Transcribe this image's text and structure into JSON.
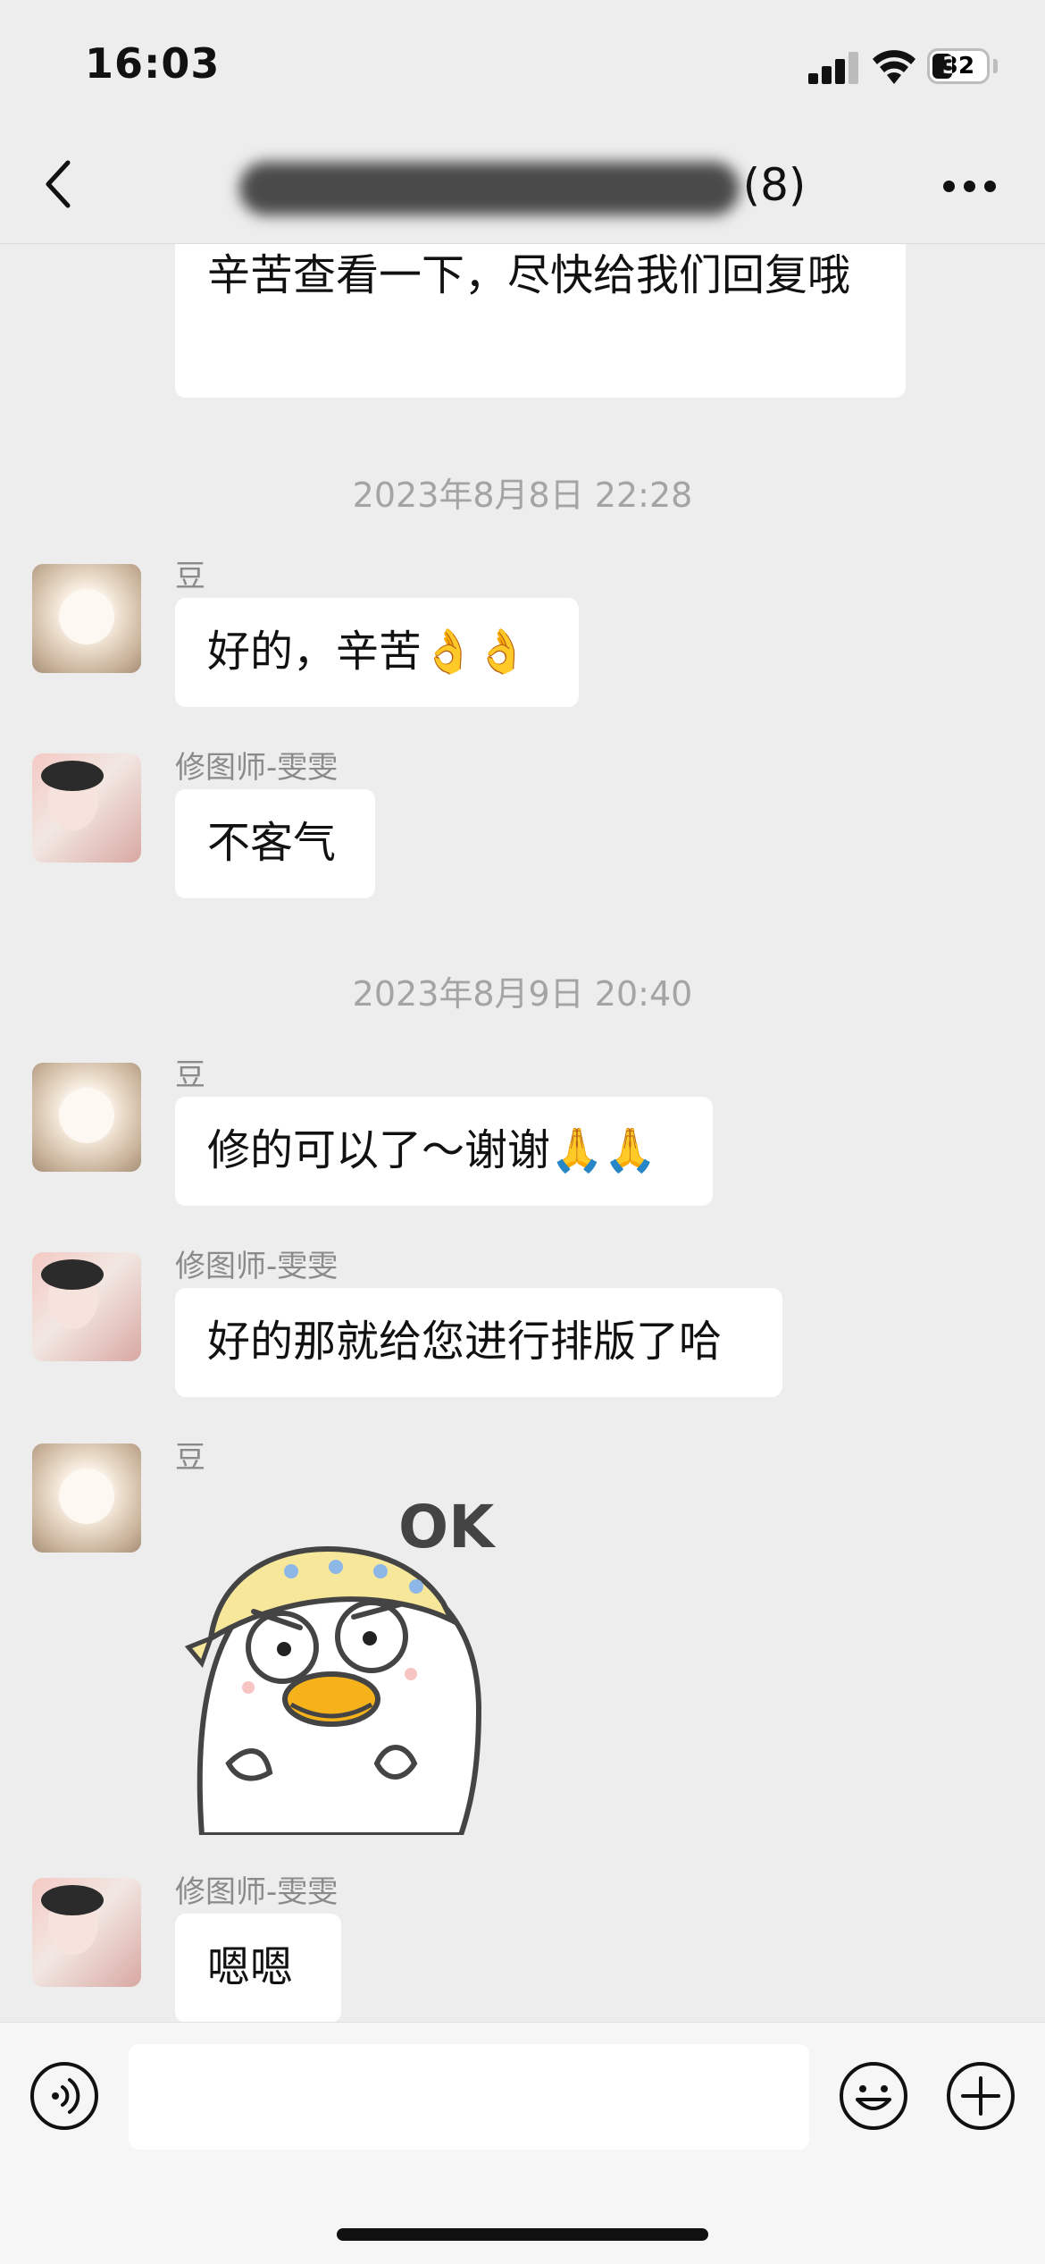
{
  "status_bar": {
    "time": "16:03",
    "battery": "32"
  },
  "header": {
    "title_visible": "27 12",
    "member_count": "(8)"
  },
  "messages": [
    {
      "text": "辛苦查看一下，尽快给我们回复哦"
    },
    {
      "timestamp": "2023年8月8日 22:28"
    },
    {
      "sender": "豆",
      "text": "好的，辛苦👌👌"
    },
    {
      "sender": "修图师-雯雯",
      "text": "不客气"
    },
    {
      "timestamp": "2023年8月9日 20:40"
    },
    {
      "sender": "豆",
      "text": "修的可以了～谢谢🙏🙏"
    },
    {
      "sender": "修图师-雯雯",
      "text": "好的那就给您进行排版了哈"
    },
    {
      "sender": "豆",
      "sticker_text": "OK"
    },
    {
      "sender": "修图师-雯雯",
      "text": "嗯嗯"
    }
  ],
  "icons": {
    "back": "chevron-left-icon",
    "more": "more-dots-icon",
    "voice": "voice-icon",
    "emoji": "emoji-icon",
    "plus": "plus-icon"
  }
}
